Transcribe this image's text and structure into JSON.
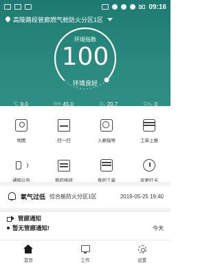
{
  "status_bar": {
    "time": "09:16",
    "left_icons": [
      "app-icon",
      "image-icon",
      "mail-icon"
    ],
    "right_icons": [
      "nfc-icon",
      "location-icon",
      "wifi-icon",
      "signal-icon",
      "battery-icon"
    ]
  },
  "header": {
    "location": "高陵路段管廊燃气舱防火分区1区",
    "bg_color": "#2a8a7f"
  },
  "gauge": {
    "label": "环境指数",
    "value": "100",
    "status": "环境良好",
    "level": 1.0
  },
  "metrics": [
    {
      "label": "℃",
      "value": "9.0"
    },
    {
      "label": "RH",
      "value": "45.0"
    },
    {
      "label": "O₂",
      "value": "20.7"
    },
    {
      "label": "CH₄",
      "value": "0"
    }
  ],
  "grid": [
    {
      "label": "地图",
      "icon": "map-icon"
    },
    {
      "label": "扫一扫",
      "icon": "scan-icon"
    },
    {
      "label": "入廊指导",
      "icon": "fingerprint-icon"
    },
    {
      "label": "工单上报",
      "icon": "report-icon"
    },
    {
      "label": "通知公告",
      "icon": "speaker-icon"
    },
    {
      "label": "我的排班",
      "icon": "calendar-icon"
    },
    {
      "label": "我的工单",
      "icon": "doc-icon"
    },
    {
      "label": "巡更打卡",
      "icon": "clock-icon"
    }
  ],
  "alert": {
    "title": "氧气过低",
    "location": "综合舱防火分区1区",
    "time": "2019-05-25 19:40"
  },
  "notice": {
    "title": "管廊通知",
    "text": "暂无管廊通知!",
    "date": "今天"
  },
  "tabbar": [
    {
      "label": "首页",
      "icon": "home-icon"
    },
    {
      "label": "工作",
      "icon": "work-icon"
    },
    {
      "label": "设置",
      "icon": "settings-icon"
    }
  ]
}
